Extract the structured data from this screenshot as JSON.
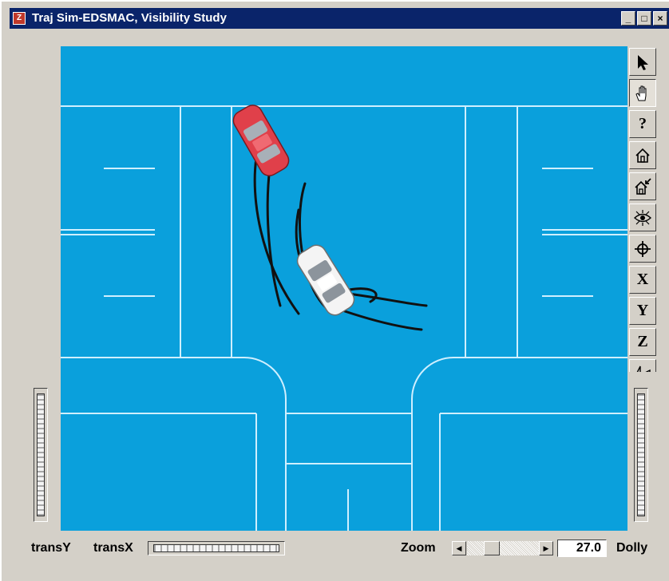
{
  "window": {
    "title": "Traj Sim-EDSMAC, Visibility Study",
    "app_icon": "edsmac-app-icon",
    "controls": [
      {
        "name": "minimize-button",
        "icon": "minimize-icon",
        "glyph": "_"
      },
      {
        "name": "maximize-button",
        "icon": "maximize-icon",
        "glyph": "□"
      },
      {
        "name": "close-button",
        "icon": "close-icon",
        "glyph": "×"
      }
    ]
  },
  "colors": {
    "scene_background": "#0aa0dc",
    "road_lines": "#cfefff",
    "title_bar": "#0a246a",
    "car_red": "#e0404a",
    "car_white": "#f4f4f4",
    "skid_marks": "#111111"
  },
  "scene": {
    "vehicles": [
      {
        "name": "red-car",
        "color": "red"
      },
      {
        "name": "white-car",
        "color": "white"
      }
    ]
  },
  "tools": [
    {
      "name": "select-arrow-tool",
      "icon": "arrow-pointer-icon",
      "pressed": false
    },
    {
      "name": "pan-hand-tool",
      "icon": "hand-icon",
      "pressed": true
    },
    {
      "name": "help-tool",
      "icon": "question-icon",
      "pressed": false,
      "letter": "?"
    },
    {
      "name": "home-view-tool",
      "icon": "home-icon",
      "pressed": false
    },
    {
      "name": "set-home-tool",
      "icon": "set-home-icon",
      "pressed": false
    },
    {
      "name": "view-all-tool",
      "icon": "eye-icon",
      "pressed": false
    },
    {
      "name": "seek-tool",
      "icon": "crosshair-icon",
      "pressed": false
    },
    {
      "name": "x-axis-view-tool",
      "icon": "x-axis-icon",
      "pressed": false,
      "letter": "X"
    },
    {
      "name": "y-axis-view-tool",
      "icon": "y-axis-icon",
      "pressed": false,
      "letter": "Y"
    },
    {
      "name": "z-axis-view-tool",
      "icon": "z-axis-icon",
      "pressed": false,
      "letter": "Z"
    },
    {
      "name": "perspective-tool",
      "icon": "perspective-icon",
      "pressed": false
    }
  ],
  "bottom": {
    "trans_y_label": "transY",
    "trans_x_label": "transX",
    "zoom_label": "Zoom",
    "zoom_value": "27.0",
    "zoom_slider_fraction": 0.3,
    "dolly_label": "Dolly",
    "left_arrow_icon": "arrow-left-icon",
    "right_arrow_icon": "arrow-right-icon"
  }
}
